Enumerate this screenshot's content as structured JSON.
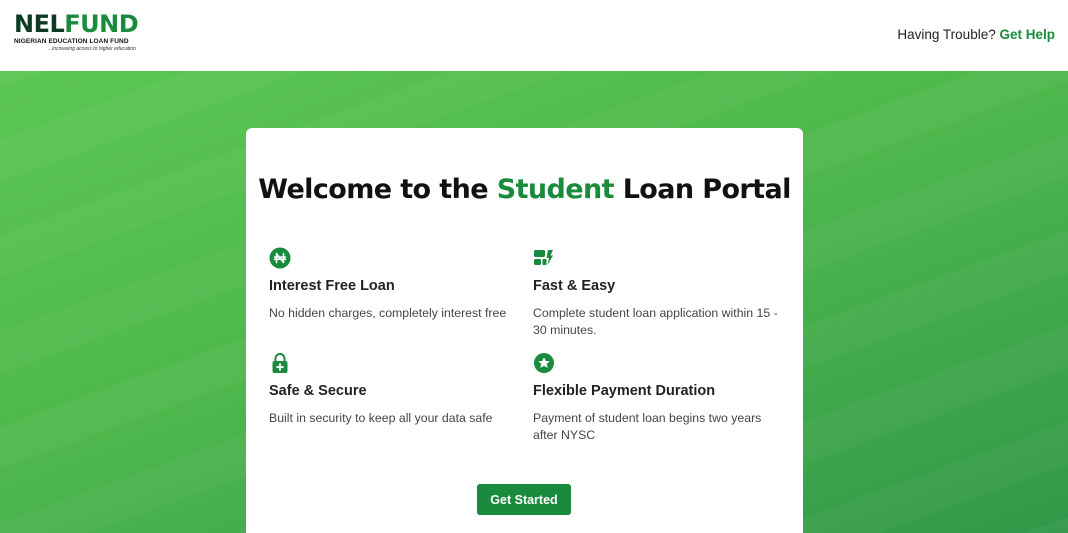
{
  "header": {
    "logo": {
      "word_main": "NEL",
      "word_accent": "FUND",
      "subtitle": "NIGERIAN EDUCATION LOAN FUND",
      "tagline": "...increasing access to higher education"
    },
    "help_text": "Having Trouble?",
    "help_link": "Get Help"
  },
  "colors": {
    "brand_green": "#1a8a3c",
    "hero_green": "#4fb84c"
  },
  "card": {
    "title_pre": "Welcome to the ",
    "title_highlight": "Student",
    "title_post": " Loan Portal",
    "features": [
      {
        "icon": "naira-coin-icon",
        "title": "Interest Free Loan",
        "description": "No hidden charges, completely interest free"
      },
      {
        "icon": "fast-form-icon",
        "title": "Fast & Easy",
        "description": "Complete student loan application within 15 - 30 minutes."
      },
      {
        "icon": "lock-icon",
        "title": "Safe & Secure",
        "description": "Built in security to keep all your data safe"
      },
      {
        "icon": "star-badge-icon",
        "title": "Flexible Payment Duration",
        "description": "Payment of student loan begins two years after NYSC"
      }
    ],
    "cta_label": "Get Started"
  }
}
